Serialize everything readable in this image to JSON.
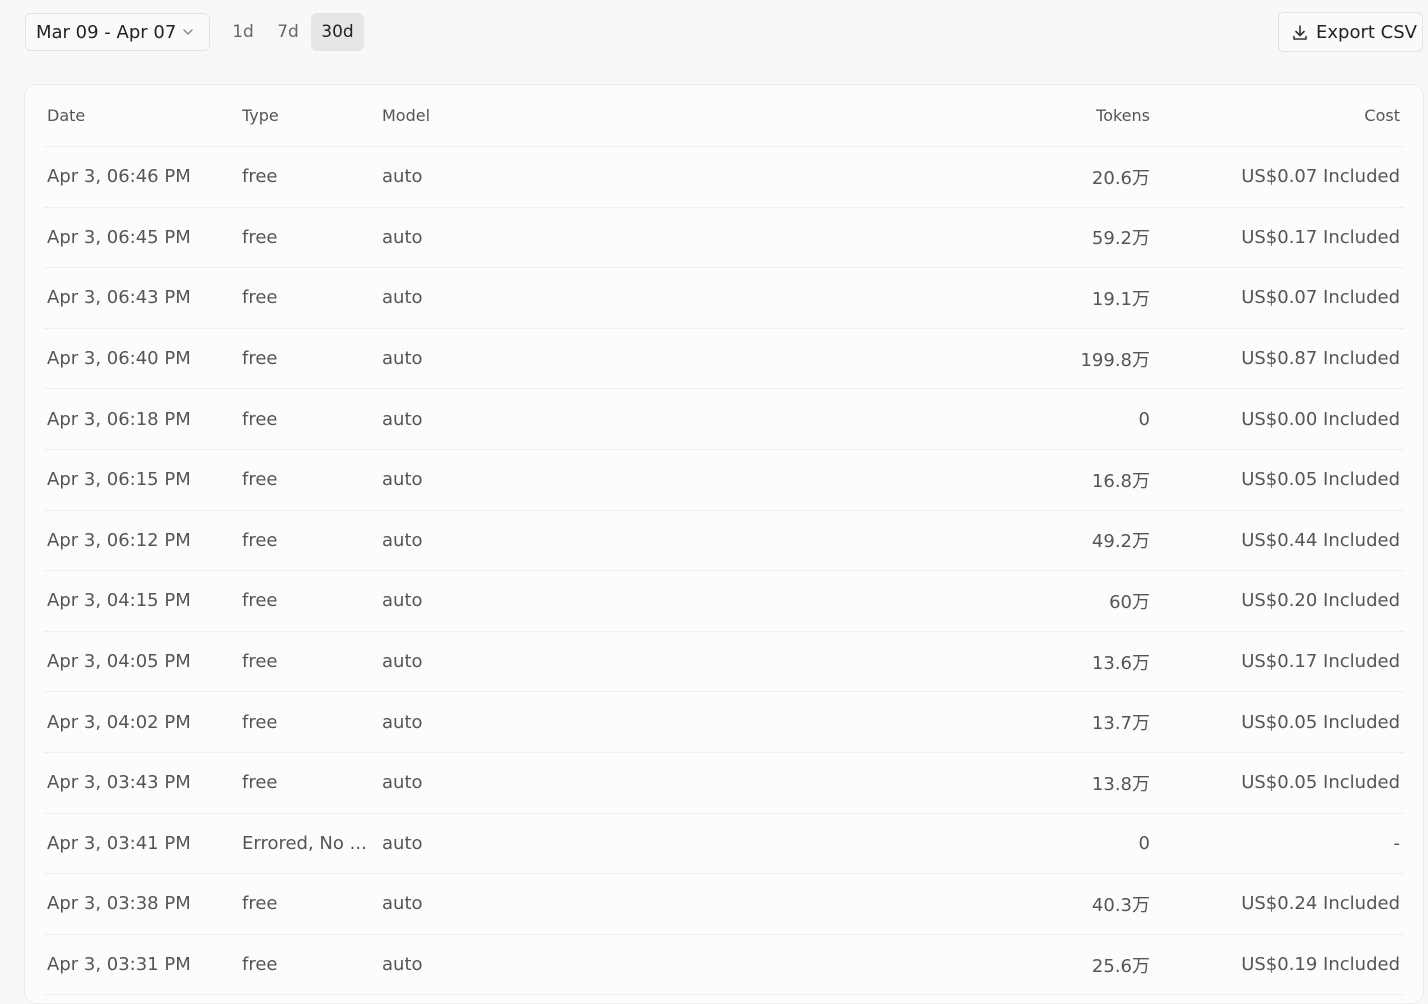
{
  "toolbar": {
    "date_range": "Mar 09 - Apr 07",
    "range_options": [
      "1d",
      "7d",
      "30d"
    ],
    "active_range": "30d",
    "export_label": "Export CSV"
  },
  "table": {
    "columns": [
      "Date",
      "Type",
      "Model",
      "Tokens",
      "Cost"
    ],
    "rows": [
      {
        "date": "Apr 3, 06:46 PM",
        "type": "free",
        "model": "auto",
        "tokens": "20.6万",
        "cost": "US$0.07 Included"
      },
      {
        "date": "Apr 3, 06:45 PM",
        "type": "free",
        "model": "auto",
        "tokens": "59.2万",
        "cost": "US$0.17 Included"
      },
      {
        "date": "Apr 3, 06:43 PM",
        "type": "free",
        "model": "auto",
        "tokens": "19.1万",
        "cost": "US$0.07 Included"
      },
      {
        "date": "Apr 3, 06:40 PM",
        "type": "free",
        "model": "auto",
        "tokens": "199.8万",
        "cost": "US$0.87 Included"
      },
      {
        "date": "Apr 3, 06:18 PM",
        "type": "free",
        "model": "auto",
        "tokens": "0",
        "cost": "US$0.00 Included"
      },
      {
        "date": "Apr 3, 06:15 PM",
        "type": "free",
        "model": "auto",
        "tokens": "16.8万",
        "cost": "US$0.05 Included"
      },
      {
        "date": "Apr 3, 06:12 PM",
        "type": "free",
        "model": "auto",
        "tokens": "49.2万",
        "cost": "US$0.44 Included"
      },
      {
        "date": "Apr 3, 04:15 PM",
        "type": "free",
        "model": "auto",
        "tokens": "60万",
        "cost": "US$0.20 Included"
      },
      {
        "date": "Apr 3, 04:05 PM",
        "type": "free",
        "model": "auto",
        "tokens": "13.6万",
        "cost": "US$0.17 Included"
      },
      {
        "date": "Apr 3, 04:02 PM",
        "type": "free",
        "model": "auto",
        "tokens": "13.7万",
        "cost": "US$0.05 Included"
      },
      {
        "date": "Apr 3, 03:43 PM",
        "type": "free",
        "model": "auto",
        "tokens": "13.8万",
        "cost": "US$0.05 Included"
      },
      {
        "date": "Apr 3, 03:41 PM",
        "type": "Errored, No ...",
        "model": "auto",
        "tokens": "0",
        "cost": "-"
      },
      {
        "date": "Apr 3, 03:38 PM",
        "type": "free",
        "model": "auto",
        "tokens": "40.3万",
        "cost": "US$0.24 Included"
      },
      {
        "date": "Apr 3, 03:31 PM",
        "type": "free",
        "model": "auto",
        "tokens": "25.6万",
        "cost": "US$0.19 Included"
      }
    ]
  }
}
